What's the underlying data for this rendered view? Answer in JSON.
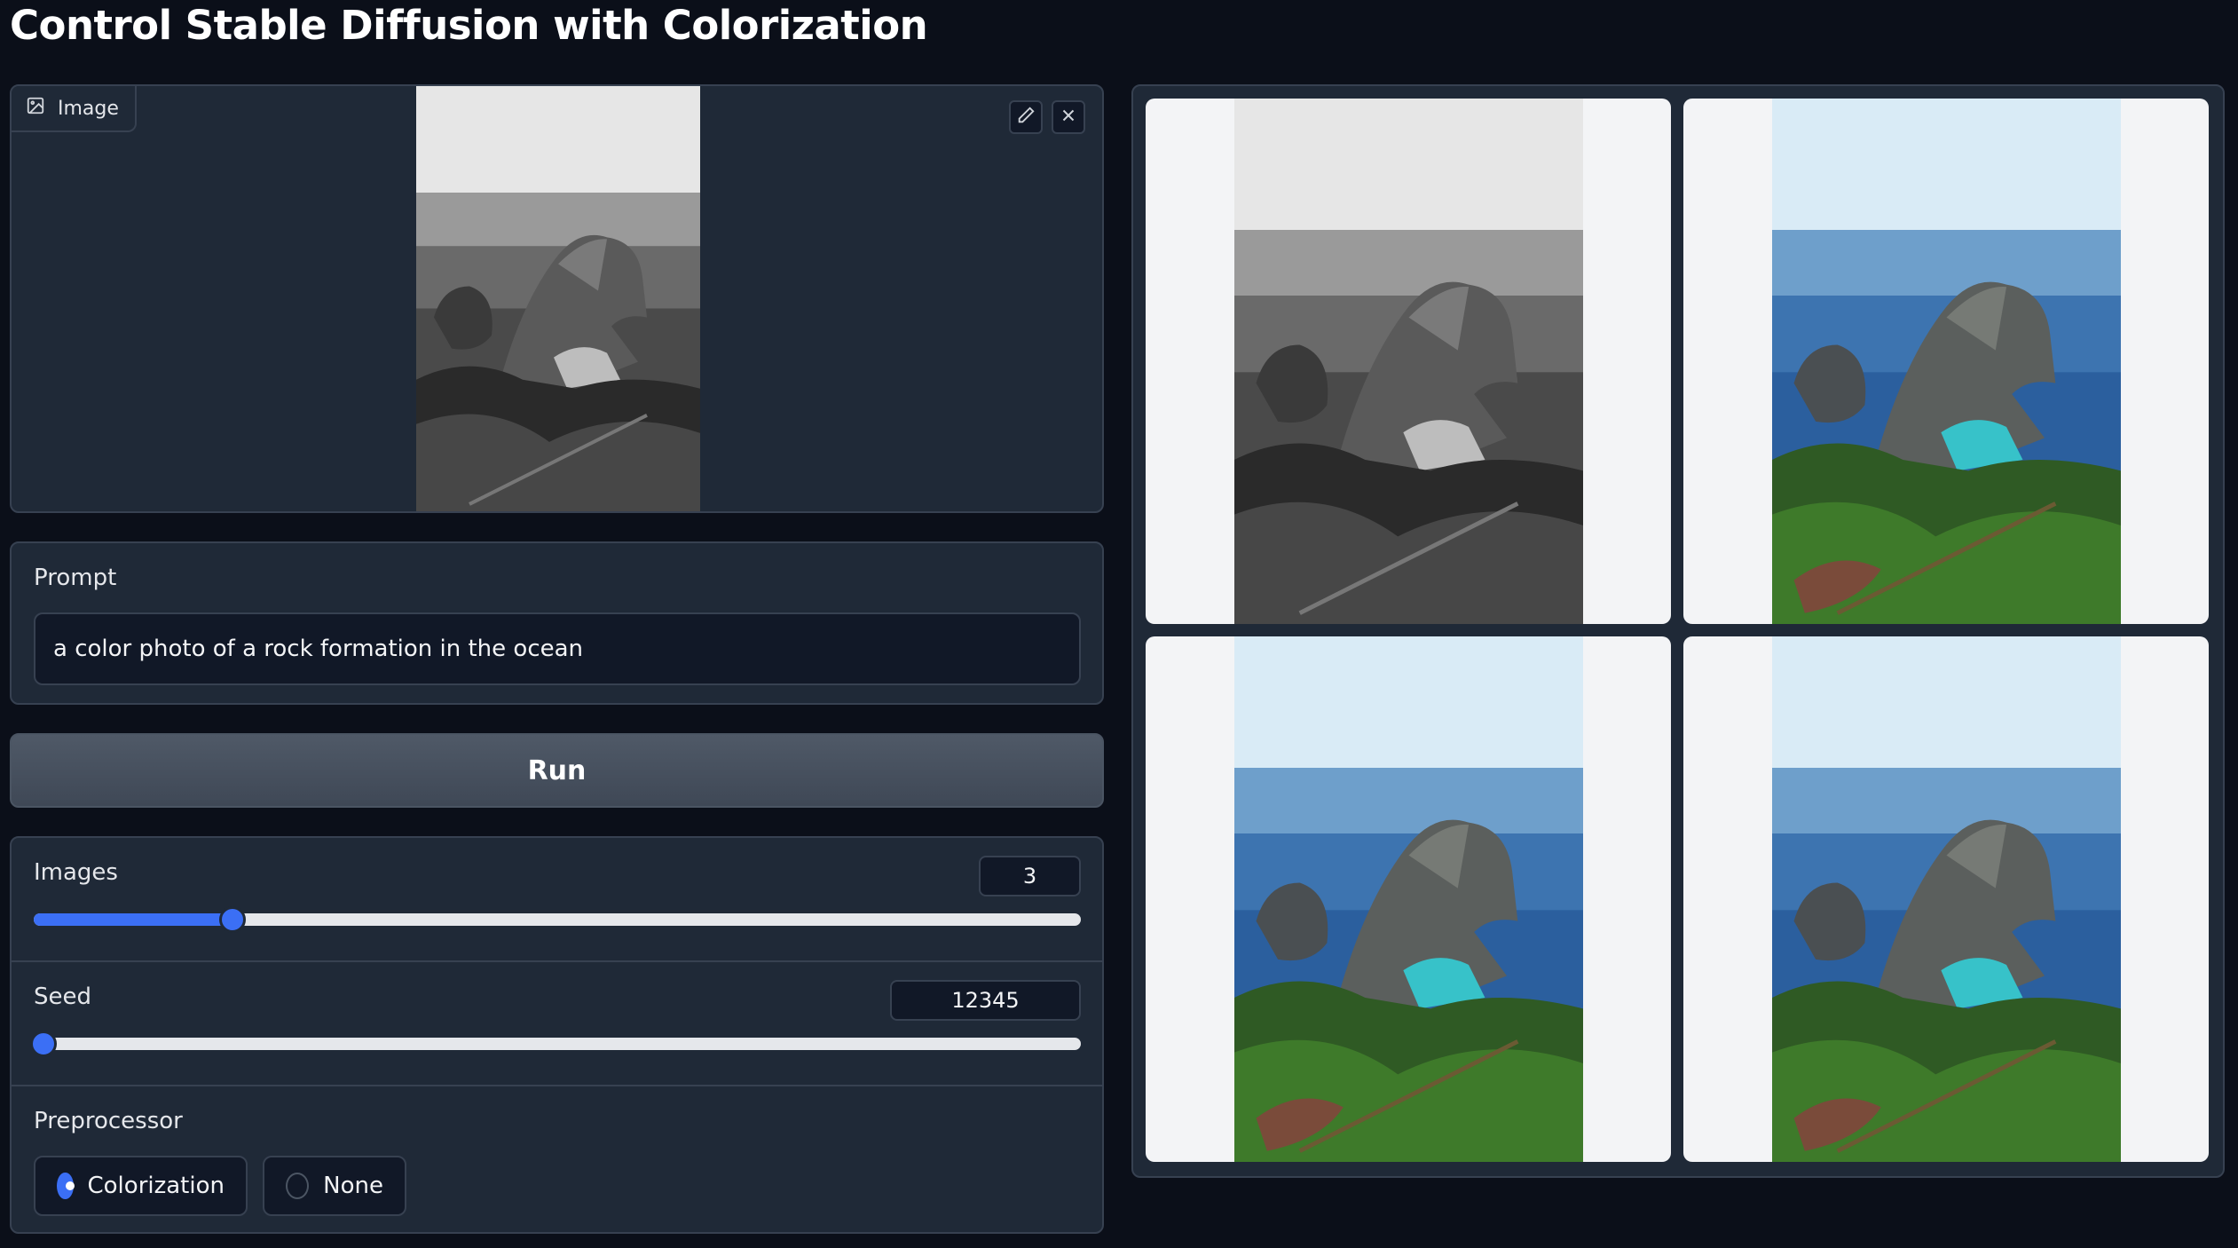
{
  "app": {
    "title": "Control Stable Diffusion with Colorization"
  },
  "image_input": {
    "label": "Image",
    "label_icon": "image-icon",
    "edit_icon": "pencil-icon",
    "clear_icon": "close-icon"
  },
  "prompt": {
    "label": "Prompt",
    "value": "a color photo of a rock formation in the ocean"
  },
  "run_button": {
    "label": "Run"
  },
  "images_slider": {
    "label": "Images",
    "value": "3",
    "fraction": 0.19
  },
  "seed_slider": {
    "label": "Seed",
    "value": "12345",
    "fraction": 0.0
  },
  "preprocessor": {
    "label": "Preprocessor",
    "options": [
      "Colorization",
      "None"
    ],
    "selected": "Colorization"
  },
  "gallery": {
    "items": [
      {
        "variant": "grayscale"
      },
      {
        "variant": "color"
      },
      {
        "variant": "color"
      },
      {
        "variant": "color"
      }
    ]
  },
  "colors": {
    "accent": "#3b6ff5",
    "background": "#0b0f19",
    "panel": "#1f2937",
    "border": "#374151"
  }
}
